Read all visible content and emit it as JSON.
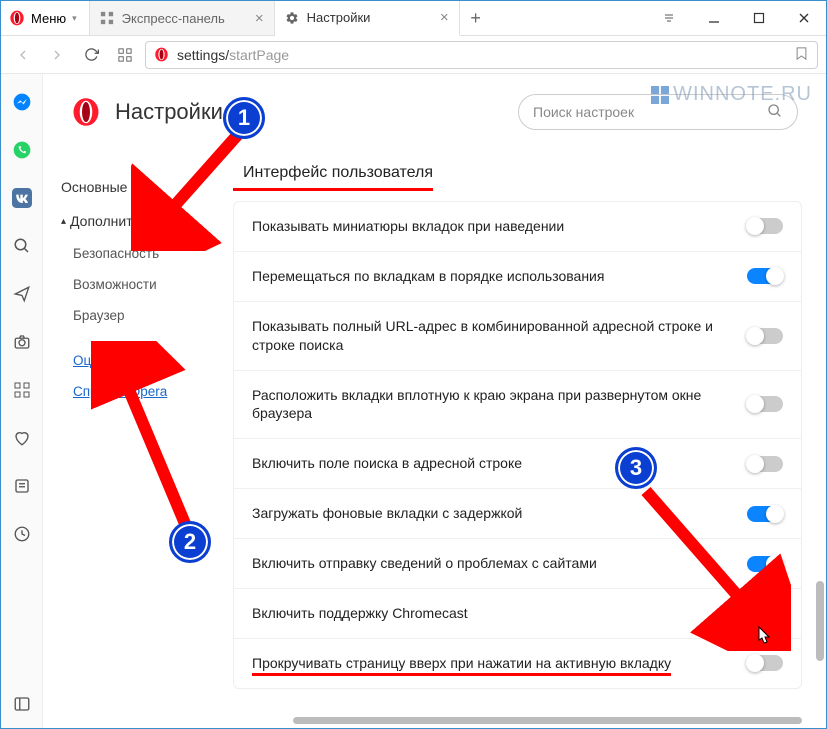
{
  "titlebar": {
    "menu_label": "Меню",
    "tabs": [
      {
        "label": "Экспресс-панель",
        "icon": "speed-dial-icon"
      },
      {
        "label": "Настройки",
        "icon": "gear-icon"
      }
    ]
  },
  "navbar": {
    "url_scheme_icon": "opera-icon",
    "url_part1": "settings/",
    "url_part2": "startPage"
  },
  "watermark": "WINNOTE.RU",
  "header": {
    "title": "Настройки",
    "search_placeholder": "Поиск настроек"
  },
  "sidebar": {
    "basic": "Основные",
    "advanced": "Дополнительно",
    "subs": [
      "Безопасность",
      "Возможности",
      "Браузер"
    ],
    "links": [
      "Оценить Opera",
      "Справка Opera"
    ]
  },
  "section": {
    "title": "Интерфейс пользователя",
    "rows": [
      {
        "label": "Показывать миниатюры вкладок при наведении",
        "on": false
      },
      {
        "label": "Перемещаться по вкладкам в порядке использования",
        "on": true
      },
      {
        "label": "Показывать полный URL-адрес в комбинированной адресной строке и строке поиска",
        "on": false
      },
      {
        "label": "Расположить вкладки вплотную к краю экрана при развернутом окне браузера",
        "on": false
      },
      {
        "label": "Включить поле поиска в адресной строке",
        "on": false
      },
      {
        "label": "Загружать фоновые вкладки с задержкой",
        "on": true
      },
      {
        "label": "Включить отправку сведений о проблемах с сайтами",
        "on": true
      },
      {
        "label": "Включить поддержку Chromecast",
        "on": false
      },
      {
        "label": "Прокручивать страницу вверх при нажатии на активную вкладку",
        "on": false
      }
    ]
  },
  "annotations": {
    "b1": "1",
    "b2": "2",
    "b3": "3"
  }
}
